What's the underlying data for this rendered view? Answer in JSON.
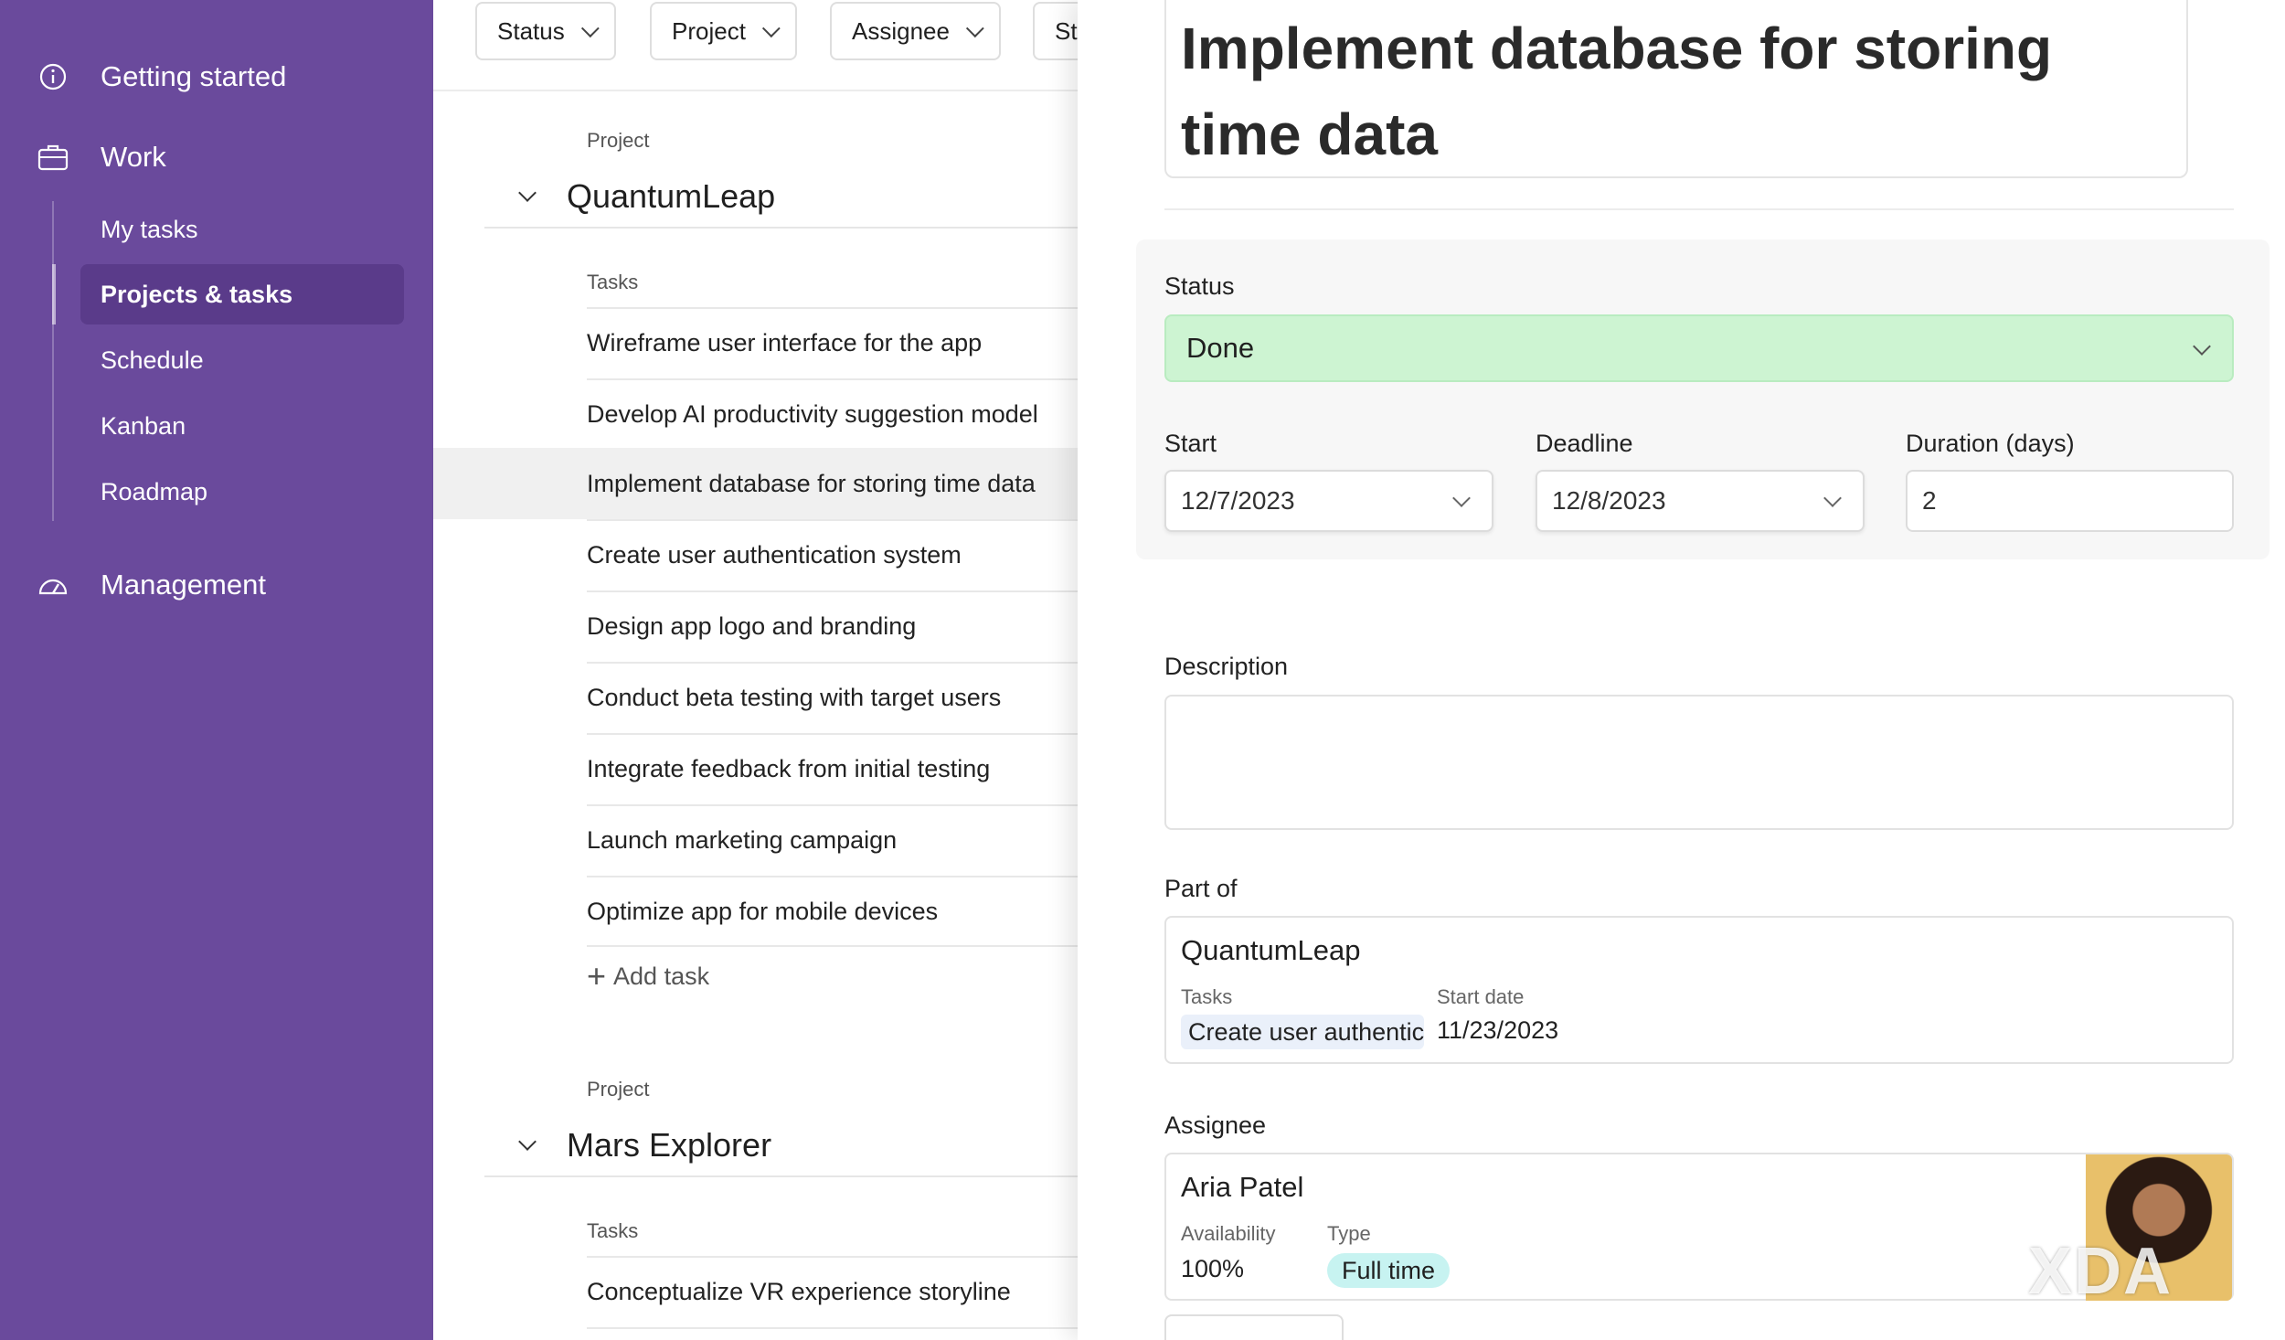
{
  "sidebar": {
    "sections": [
      {
        "label": "Getting started",
        "icon": "info-icon"
      },
      {
        "label": "Work",
        "icon": "briefcase-icon"
      },
      {
        "label": "Management",
        "icon": "gauge-icon"
      }
    ],
    "work_items": [
      {
        "label": "My tasks"
      },
      {
        "label": "Projects & tasks",
        "active": true
      },
      {
        "label": "Schedule"
      },
      {
        "label": "Kanban"
      },
      {
        "label": "Roadmap"
      }
    ]
  },
  "filters": [
    {
      "label": "Status"
    },
    {
      "label": "Project"
    },
    {
      "label": "Assignee"
    },
    {
      "label": "St"
    }
  ],
  "projects": [
    {
      "caption": "Project",
      "name": "QuantumLeap",
      "tasks_caption": "Tasks",
      "tasks": [
        "Wireframe user interface for the app",
        "Develop AI productivity suggestion model",
        "Implement database for storing time data",
        "Create user authentication system",
        "Design app logo and branding",
        "Conduct beta testing with target users",
        "Integrate feedback from initial testing",
        "Launch marketing campaign",
        "Optimize app for mobile devices"
      ],
      "selected_task_index": 2,
      "add_task_label": "Add task"
    },
    {
      "caption": "Project",
      "name": "Mars Explorer",
      "tasks_caption": "Tasks",
      "tasks": [
        "Conceptualize VR experience storyline"
      ]
    }
  ],
  "detail": {
    "title": "Implement database for storing time data",
    "status_label": "Status",
    "status_value": "Done",
    "status_color": "#cdf4d2",
    "start_label": "Start",
    "start_value": "12/7/2023",
    "deadline_label": "Deadline",
    "deadline_value": "12/8/2023",
    "duration_label": "Duration (days)",
    "duration_value": "2",
    "description_label": "Description",
    "description_value": "",
    "part_of_label": "Part of",
    "part_of": {
      "name": "QuantumLeap",
      "tasks_label": "Tasks",
      "tasks_value": "Create user authentication system",
      "start_date_label": "Start date",
      "start_date_value": "11/23/2023"
    },
    "assignee_label": "Assignee",
    "assignee": {
      "name": "Aria Patel",
      "availability_label": "Availability",
      "availability_value": "100%",
      "type_label": "Type",
      "type_value": "Full time",
      "type_color": "#c7f3f1"
    }
  },
  "watermark": "XDA",
  "colors": {
    "sidebar_bg": "#6a4a9c",
    "active_item_bg": "#5a3b8a"
  }
}
